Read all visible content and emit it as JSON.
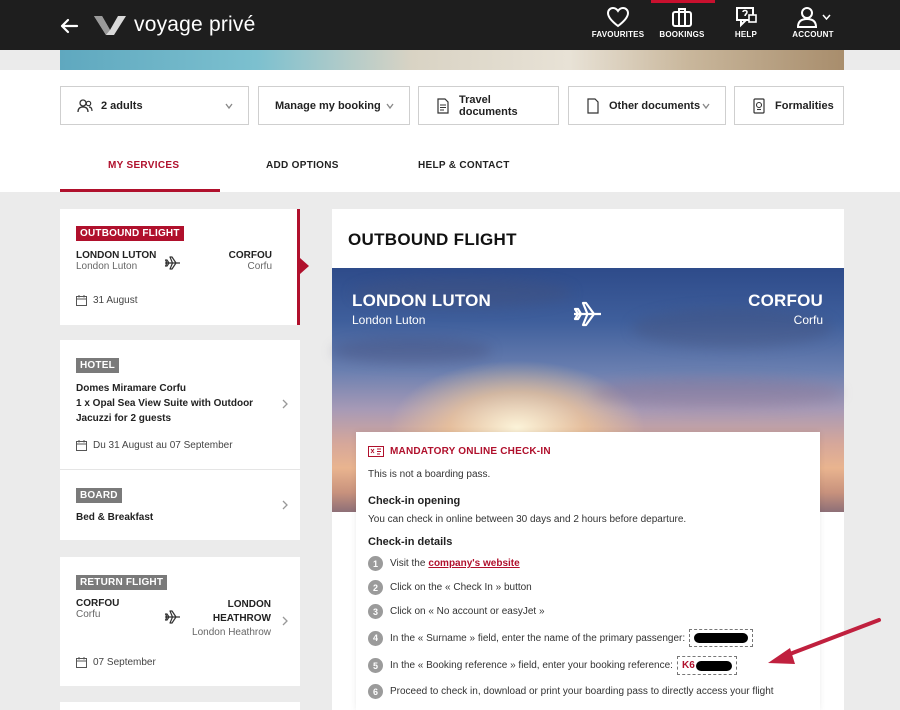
{
  "header": {
    "logo_text": "voyage privé",
    "nav": [
      {
        "label": "FAVOURITES",
        "icon": "heart-icon"
      },
      {
        "label": "BOOKINGS",
        "icon": "suitcase-icon"
      },
      {
        "label": "HELP",
        "icon": "help-chat-icon"
      },
      {
        "label": "ACCOUNT",
        "icon": "user-icon"
      }
    ]
  },
  "toolbar": {
    "adults": "2 adults",
    "manage": "Manage my booking",
    "travel_docs": "Travel documents",
    "other_docs": "Other documents",
    "formalities": "Formalities"
  },
  "tabs": {
    "services": "MY SERVICES",
    "options": "ADD OPTIONS",
    "help": "HELP & CONTACT"
  },
  "sidebar": {
    "outbound": {
      "badge": "OUTBOUND FLIGHT",
      "from_city": "LONDON LUTON",
      "from_sub": "London Luton",
      "to_city": "CORFOU",
      "to_sub": "Corfu",
      "date": "31 August"
    },
    "hotel": {
      "badge": "HOTEL",
      "name_line1": "Domes Miramare Corfu",
      "name_line2": "1 x Opal Sea View Suite with Outdoor",
      "name_line3": "Jacuzzi for 2 guests",
      "date": "Du 31 August au 07 September"
    },
    "board": {
      "badge": "BOARD",
      "value": "Bed & Breakfast"
    },
    "return": {
      "badge": "RETURN FLIGHT",
      "from_city": "CORFOU",
      "from_sub": "Corfu",
      "to_city_line1": "LONDON",
      "to_city_line2": "HEATHROW",
      "to_sub": "London Heathrow",
      "date": "07 September"
    }
  },
  "main": {
    "title": "OUTBOUND FLIGHT",
    "from_city": "LONDON LUTON",
    "from_sub": "London Luton",
    "to_city": "CORFOU",
    "to_sub": "Corfu",
    "checkin": {
      "title": "MANDATORY ONLINE CHECK-IN",
      "note": "This is not a boarding pass.",
      "opening_head": "Check-in opening",
      "opening_text": "You can check in online between 30 days and 2 hours before departure.",
      "details_head": "Check-in details",
      "steps": [
        {
          "n": "1",
          "text": "Visit the",
          "link": "company's website"
        },
        {
          "n": "2",
          "text": "Click on the « Check In » button"
        },
        {
          "n": "3",
          "text": "Click on « No account or easyJet »"
        },
        {
          "n": "4",
          "text": "In the « Surname » field, enter the name of the primary passenger:"
        },
        {
          "n": "5",
          "text": "In the « Booking reference » field, enter your booking reference:",
          "ref_prefix": "K6"
        },
        {
          "n": "6",
          "text": "Proceed to check in, download or print your boarding pass to directly access your flight"
        }
      ]
    }
  },
  "colors": {
    "accent": "#b0102c",
    "header_bg": "#1e1e1e",
    "page_bg": "#ebebeb"
  }
}
